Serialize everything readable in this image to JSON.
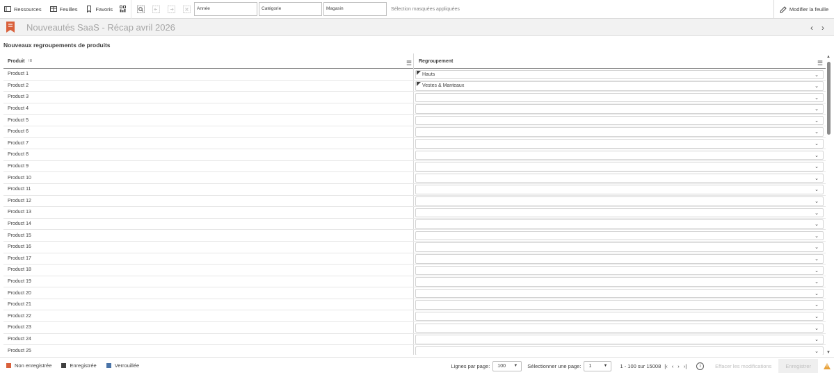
{
  "toolbar": {
    "resources_label": "Ressources",
    "sheets_label": "Feuilles",
    "bookmarks_label": "Favoris",
    "filters": [
      "Année",
      "Catégorie",
      "Magasin"
    ],
    "selection_status": "Sélection masquées appliquées",
    "edit_sheet_label": "Modifier la feuille"
  },
  "sheet": {
    "title": "Nouveautés SaaS - Récap avril 2026"
  },
  "table": {
    "title": "Nouveaux regroupements de produits",
    "col_product": "Produit",
    "col_group": "Regroupement",
    "rows": [
      {
        "product": "Product 1",
        "group": "Hauts"
      },
      {
        "product": "Product 2",
        "group": "Vestes & Manteaux"
      },
      {
        "product": "Product 3",
        "group": ""
      },
      {
        "product": "Product 4",
        "group": ""
      },
      {
        "product": "Product 5",
        "group": ""
      },
      {
        "product": "Product 6",
        "group": ""
      },
      {
        "product": "Product 7",
        "group": ""
      },
      {
        "product": "Product 8",
        "group": ""
      },
      {
        "product": "Product 9",
        "group": ""
      },
      {
        "product": "Product 10",
        "group": ""
      },
      {
        "product": "Product 11",
        "group": ""
      },
      {
        "product": "Product 12",
        "group": ""
      },
      {
        "product": "Product 13",
        "group": ""
      },
      {
        "product": "Product 14",
        "group": ""
      },
      {
        "product": "Product 15",
        "group": ""
      },
      {
        "product": "Product 16",
        "group": ""
      },
      {
        "product": "Product 17",
        "group": ""
      },
      {
        "product": "Product 18",
        "group": ""
      },
      {
        "product": "Product 19",
        "group": ""
      },
      {
        "product": "Product 20",
        "group": ""
      },
      {
        "product": "Product 21",
        "group": ""
      },
      {
        "product": "Product 22",
        "group": ""
      },
      {
        "product": "Product 23",
        "group": ""
      },
      {
        "product": "Product 24",
        "group": ""
      },
      {
        "product": "Product 25",
        "group": ""
      }
    ]
  },
  "footer": {
    "legend": [
      {
        "label": "Non enregistrée",
        "color": "#d9603b"
      },
      {
        "label": "Enregistrée",
        "color": "#404040"
      },
      {
        "label": "Verrouillée",
        "color": "#4a74a8"
      }
    ],
    "rows_per_page_label": "Lignes par page:",
    "rows_per_page_value": "100",
    "select_page_label": "Sélectionner une page:",
    "page_value": "1",
    "range_text": "1 - 100 sur 15008",
    "discard_label": "Effacer les modifications",
    "save_label": "Enregistrer"
  },
  "colors": {
    "bookmark_accent": "#d9603b",
    "warning": "#e8a23b"
  }
}
